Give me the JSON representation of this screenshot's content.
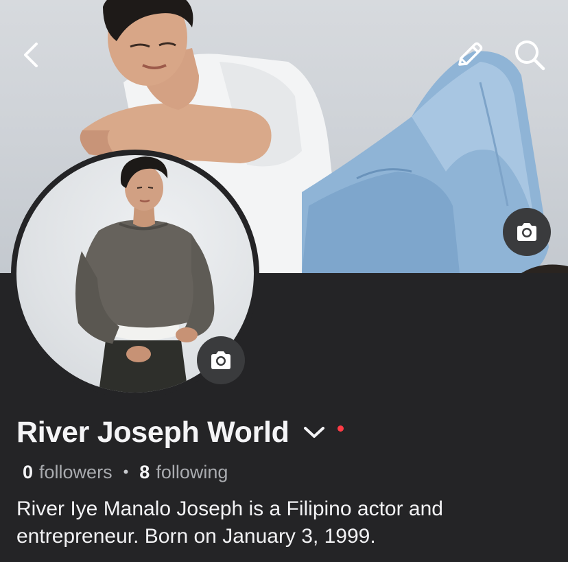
{
  "header": {
    "back_icon": "chevron-left-icon",
    "edit_icon": "pencil-icon",
    "search_icon": "search-icon",
    "cover_camera_icon": "camera-icon"
  },
  "profile": {
    "name": "River Joseph World",
    "avatar_camera_icon": "camera-icon",
    "dropdown_icon": "chevron-down-icon",
    "notification_dot_color": "#ff3b45",
    "followers_count": "0",
    "followers_label": "followers",
    "separator": "•",
    "following_count": "8",
    "following_label": "following",
    "bio": "River Iye Manalo Joseph is a Filipino actor and entrepreneur. Born on January 3, 1999."
  },
  "colors": {
    "background": "#242426",
    "text_primary": "#f4f4f6",
    "text_secondary": "#a9abaf",
    "button_dark": "#3a3b3d"
  }
}
